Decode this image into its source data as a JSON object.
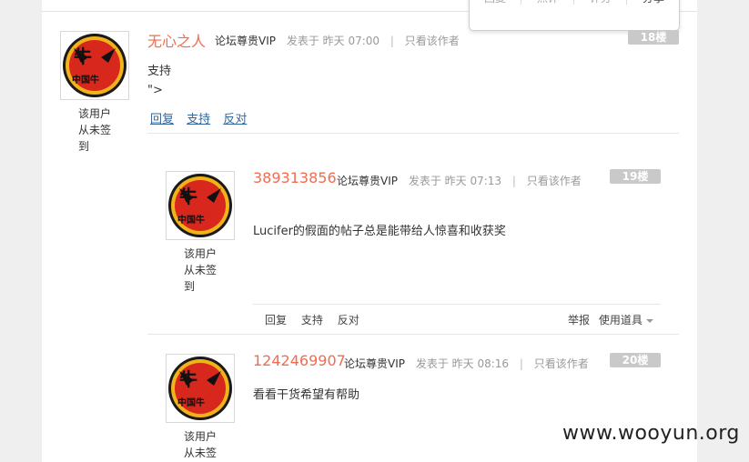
{
  "float_menu": {
    "items": [
      "回复",
      "点评",
      "评分",
      "分享"
    ]
  },
  "prev_cut_text": "- - - - - - - - - -",
  "posts": [
    {
      "author": "无心之人",
      "rank": "论坛尊贵VIP",
      "posted": "发表于 昨天 07:00",
      "only_author": "只看该作者",
      "floor": "18楼",
      "signin": [
        "该用户",
        "从未签",
        "到"
      ],
      "content": [
        "支持",
        "\">"
      ],
      "actions": [
        "回复",
        "支持",
        "反对"
      ]
    },
    {
      "author": "389313856",
      "rank": "论坛尊贵VIP",
      "posted": "发表于 昨天 07:13",
      "only_author": "只看该作者",
      "floor": "19楼",
      "signin": [
        "该用户",
        "从未签",
        "到"
      ],
      "content": [
        "Lucifer的假面的帖子总是能带给人惊喜和收获奖"
      ],
      "actions": [
        "回复",
        "支持",
        "反对"
      ],
      "report": "举报",
      "use_tool": "使用道具"
    },
    {
      "author": "1242469907",
      "rank": "论坛尊贵VIP",
      "posted": "发表于 昨天 08:16",
      "only_author": "只看该作者",
      "floor": "20楼",
      "signin": [
        "该用户",
        "从未签"
      ],
      "content": [
        "看看干货希望有帮助"
      ]
    }
  ],
  "avatar_icon": "bull-logo-avatar",
  "watermark": "www.wooyun.org",
  "colors": {
    "author": "#f26c4f",
    "link": "#336699",
    "floor_badge": "#c9c9c9"
  }
}
